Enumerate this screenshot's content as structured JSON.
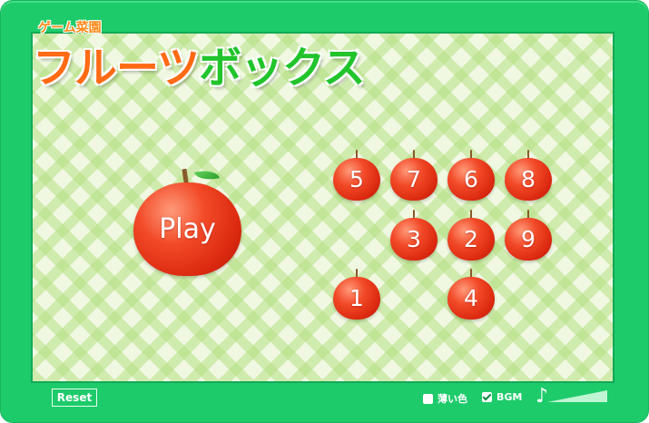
{
  "header": {
    "subtitle": "ゲーム菜園",
    "title_part1": "フルーツ",
    "title_part2": "ボックス"
  },
  "play_apple": {
    "label": "Play"
  },
  "apples": [
    {
      "label": "5"
    },
    {
      "label": "7"
    },
    {
      "label": "6"
    },
    {
      "label": "8"
    },
    {
      "label": "3"
    },
    {
      "label": "2"
    },
    {
      "label": "9"
    },
    {
      "label": "1"
    },
    {
      "label": "4"
    }
  ],
  "footer": {
    "reset_label": "Reset",
    "pale_color_label": "薄い色",
    "pale_color_checked": false,
    "bgm_label": "BGM",
    "bgm_checked": true,
    "music_icon": "music-note-icon"
  },
  "colors": {
    "frame": "#1ecb6b",
    "board": "#f0f8e2",
    "title_orange": "#ff6a14",
    "title_green": "#22c42c",
    "apple_red": "#e8381a"
  }
}
